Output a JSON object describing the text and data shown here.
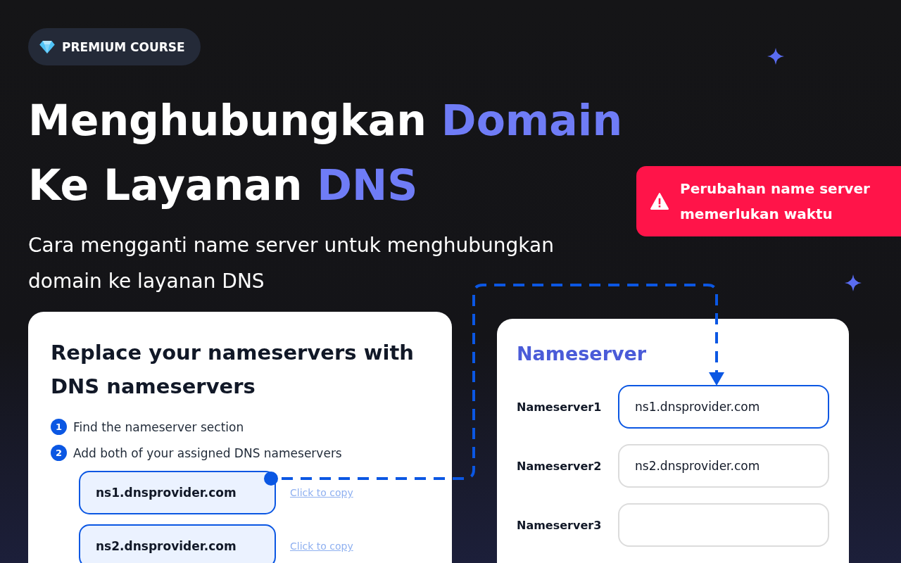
{
  "badge": {
    "label": "PREMIUM COURSE"
  },
  "title": {
    "lines": [
      [
        {
          "text": "Menghubungkan ",
          "highlight": false
        },
        {
          "text": "Domain",
          "highlight": true
        }
      ],
      [
        {
          "text": "Ke Layanan ",
          "highlight": false
        },
        {
          "text": "DNS",
          "highlight": true
        }
      ]
    ]
  },
  "subtitle": "Cara mengganti name server untuk menghubungkan domain ke layanan DNS",
  "alert": {
    "text": "Perubahan name server memerlukan waktu"
  },
  "instructions_card": {
    "title": "Replace your nameservers with DNS nameservers",
    "steps": [
      {
        "number": "1",
        "text": "Find the nameserver section"
      },
      {
        "number": "2",
        "text": "Add both of your assigned DNS nameservers"
      }
    ],
    "nameservers": [
      {
        "value": "ns1.dnsprovider.com",
        "link": "Click to copy"
      },
      {
        "value": "ns2.dnsprovider.com",
        "link": "Click to copy"
      }
    ]
  },
  "nameserver_form": {
    "title": "Nameserver",
    "fields": [
      {
        "label": "Nameserver1",
        "value": "ns1.dnsprovider.com",
        "focused": true
      },
      {
        "label": "Nameserver2",
        "value": "ns2.dnsprovider.com",
        "focused": false
      },
      {
        "label": "Nameserver3",
        "focused": false
      }
    ]
  }
}
